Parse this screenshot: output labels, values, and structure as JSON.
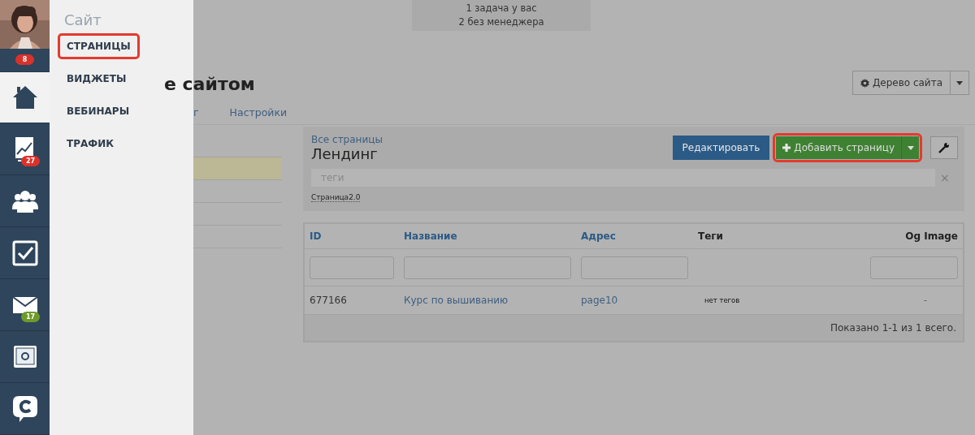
{
  "nav": {
    "badge": "8",
    "items": [
      {
        "kind": "home",
        "selected": true
      },
      {
        "kind": "chart",
        "selected": false,
        "badge": "27",
        "color": "#d9322b"
      },
      {
        "kind": "people",
        "selected": false
      },
      {
        "kind": "check",
        "selected": false
      },
      {
        "kind": "mail",
        "selected": false,
        "badge": "17",
        "color": "#6e9a2a"
      },
      {
        "kind": "safe",
        "selected": false
      },
      {
        "kind": "chat",
        "selected": false
      }
    ]
  },
  "submenu": {
    "title": "Сайт",
    "items": [
      {
        "label": "СТРАНИЦЫ",
        "highlighted": true
      },
      {
        "label": "ВИДЖЕТЫ",
        "highlighted": false
      },
      {
        "label": "ВЕБИНАРЫ",
        "highlighted": false
      },
      {
        "label": "ТРАФИК",
        "highlighted": false
      }
    ]
  },
  "notice": [
    "1 задача у вас",
    "2 без менеджера"
  ],
  "page_title": "е сайтом",
  "tree_button": "Дерево сайта",
  "tabs": [
    {
      "label": "г",
      "selected": false
    },
    {
      "label": "Настройки",
      "selected": false
    }
  ],
  "list_rows": [
    {
      "selected": false
    },
    {
      "selected": true
    },
    {
      "selected": false
    },
    {
      "selected": false
    },
    {
      "selected": false
    }
  ],
  "panel": {
    "breadcrumb": "Все страницы",
    "title": "Лендинг",
    "edit_button": "Редактировать",
    "add_button": "Добавить страницу",
    "add_highlighted": true,
    "tags_placeholder": "теги",
    "clear": "×",
    "tag": "Страница2.0"
  },
  "table": {
    "columns": [
      {
        "label": "ID",
        "link": true,
        "filter": true
      },
      {
        "label": "Название",
        "link": true,
        "filter": true
      },
      {
        "label": "Адрес",
        "link": true,
        "filter": true
      },
      {
        "label": "Теги",
        "link": false,
        "filter": false
      },
      {
        "label": "Og Image",
        "link": false,
        "filter": true
      }
    ],
    "rows": [
      [
        "677166",
        "Курс по вышиванию",
        "page10",
        "нет тегов",
        "-"
      ]
    ],
    "summary": "Показано 1-1 из 1 всего."
  }
}
